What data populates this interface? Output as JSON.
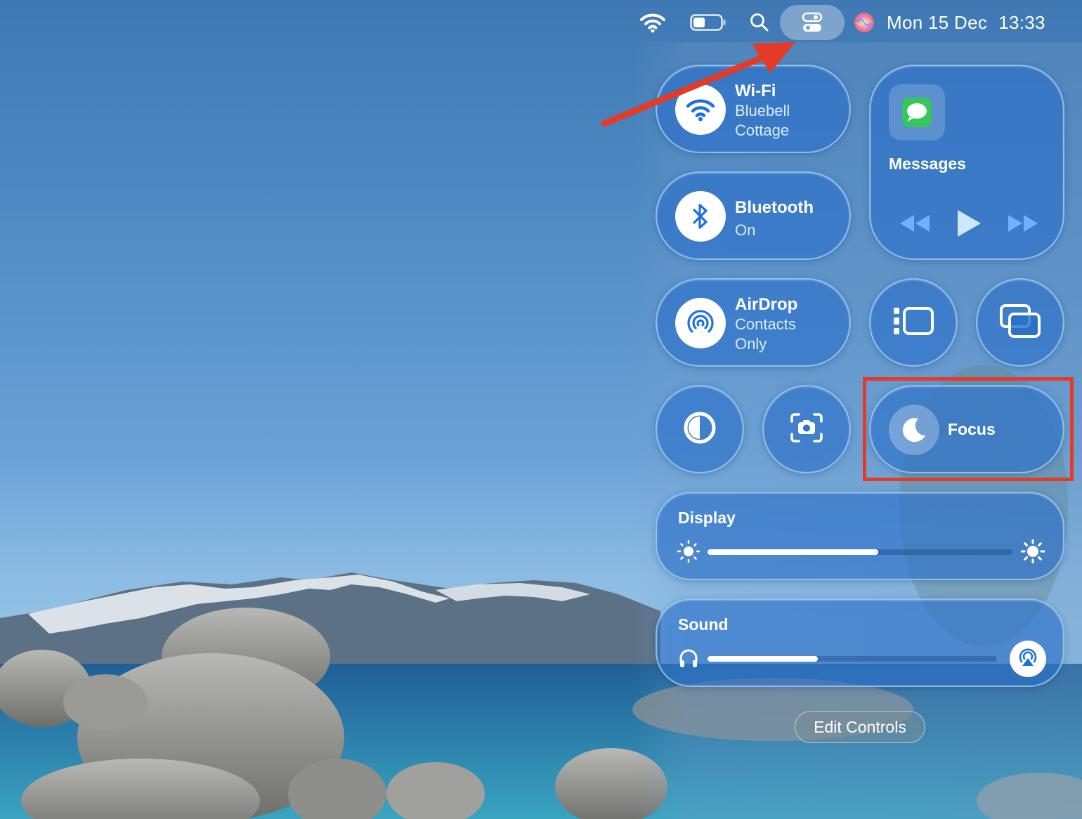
{
  "menubar": {
    "date": "Mon 15 Dec",
    "time": "13:33",
    "icons": [
      "wifi-icon",
      "battery-icon",
      "search-icon",
      "control-centre-icon",
      "siri-icon"
    ]
  },
  "control_centre": {
    "wifi": {
      "title": "Wi-Fi",
      "network_line1": "Bluebell",
      "network_line2": "Cottage"
    },
    "bluetooth": {
      "title": "Bluetooth",
      "status": "On"
    },
    "airdrop": {
      "title": "AirDrop",
      "status_line1": "Contacts",
      "status_line2": "Only"
    },
    "media": {
      "app": "Messages"
    },
    "focus": {
      "label": "Focus"
    },
    "display": {
      "label": "Display",
      "brightness": 0.56
    },
    "sound": {
      "label": "Sound",
      "volume": 0.38
    },
    "edit_label": "Edit Controls"
  },
  "annotations": {
    "arrow_color": "#e53a26",
    "highlight_color": "#e53a26"
  },
  "accent": "#2f6fd6"
}
